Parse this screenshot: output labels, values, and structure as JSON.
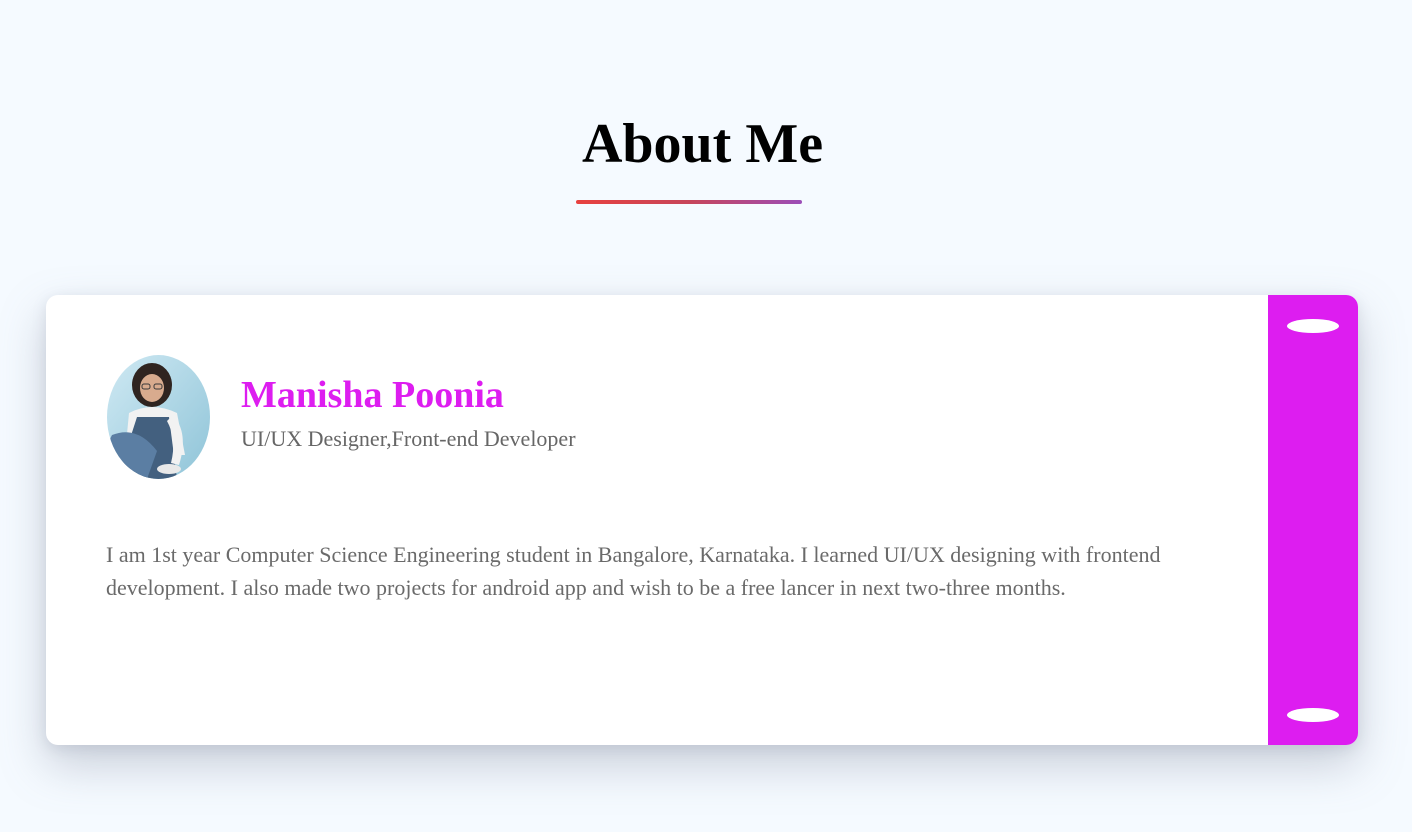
{
  "section": {
    "title": "About Me"
  },
  "profile": {
    "name": "Manisha Poonia",
    "role": "UI/UX Designer,Front-end Developer",
    "bio": "I am 1st year Computer Science Engineering student in Bangalore, Karnataka. I learned UI/UX designing with frontend development. I also made two projects for android app and wish to be a free lancer in next two-three months."
  },
  "colors": {
    "accent": "#dd1df0",
    "underline_start": "#e8413f",
    "underline_end": "#9b4db8",
    "background": "#f5faff",
    "card": "#ffffff",
    "text_muted": "#6a6a6a"
  },
  "icons": {
    "avatar": "profile-photo"
  }
}
